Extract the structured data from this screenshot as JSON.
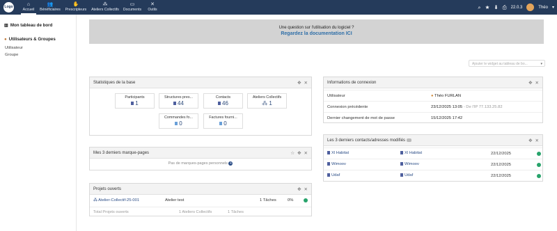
{
  "nav": {
    "logo_text": "Logo",
    "items": [
      {
        "label": "Accueil",
        "icon": "home-icon"
      },
      {
        "label": "Bénéficiaires",
        "icon": "users-icon"
      },
      {
        "label": "Prescripteurs",
        "icon": "handshake-icon"
      },
      {
        "label": "Ateliers Collectifs",
        "icon": "network-icon"
      },
      {
        "label": "Documents",
        "icon": "folder-icon"
      },
      {
        "label": "Outils",
        "icon": "tools-icon"
      }
    ],
    "version": "22.0.3",
    "user": "Théo",
    "accent": "#253b5b"
  },
  "sidebar": {
    "dashboard_label": "Mon tableau de bord",
    "users_group_label": "Utilisateurs & Groupes",
    "items": [
      "Utilisateur",
      "Groupe"
    ]
  },
  "banner": {
    "question": "Une question sur l'utilisation du logiciel ?",
    "link": "Regardez la documentation ICI"
  },
  "widget_select": {
    "placeholder": "Ajouter le widget au tableau de bo..."
  },
  "stats": {
    "title": "Statistiques de la base",
    "items": [
      {
        "label": "Participants",
        "value": "1"
      },
      {
        "label": "Structures pres...",
        "value": "44"
      },
      {
        "label": "Contacts",
        "value": "46"
      },
      {
        "label": "Ateliers Collectifs",
        "value": "1"
      },
      {
        "label": "Commandes fo...",
        "value": "0"
      },
      {
        "label": "Factures fourni...",
        "value": "0"
      }
    ]
  },
  "bookmarks": {
    "title": "Mes 3 derniers marque-pages",
    "empty": "Pas de marques-pages personnels"
  },
  "projects": {
    "title": "Projets ouverts",
    "row": {
      "name": "Atelier-Collectif-25-001",
      "label": "Atelier test",
      "tasks": "1 Tâches",
      "progress": "0%"
    },
    "footer": {
      "total": "Total Projets ouverts",
      "ateliers": "1 Ateliers Collectifs",
      "tasks": "1 Tâches"
    }
  },
  "connexion": {
    "title": "Informations de connexion",
    "rows": [
      {
        "key": "Utilisateur",
        "value": "Théo FURLAN"
      },
      {
        "key": "Connexion précédente",
        "value": "23/12/2025 13:05",
        "extra": "- De l'IP 77.133.25.82"
      },
      {
        "key": "Dernier changement de mot de passe",
        "value": "15/12/2025 17:42"
      }
    ]
  },
  "contacts": {
    "title": "Les 3 derniers contacts/adresses modifiés",
    "rows": [
      {
        "name": "Xl Habitat",
        "company": "Xl Habitat",
        "date": "22/12/2025"
      },
      {
        "name": "Wimoov",
        "company": "Wimoov",
        "date": "22/12/2025"
      },
      {
        "name": "Udaf",
        "company": "Udaf",
        "date": "22/12/2025"
      }
    ]
  }
}
